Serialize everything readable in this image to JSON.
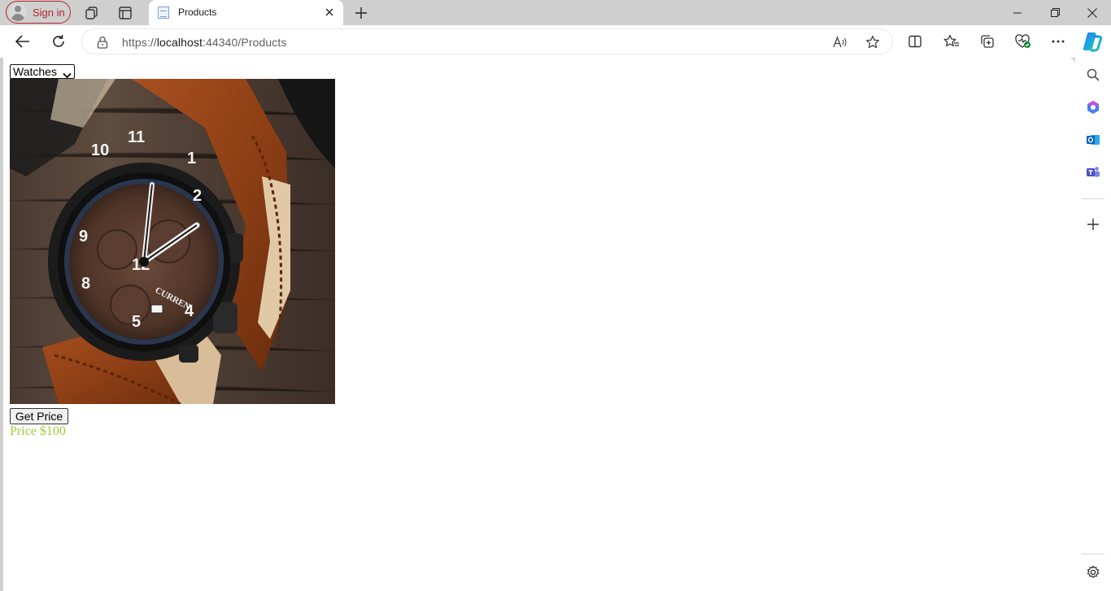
{
  "browser": {
    "signin_label": "Sign in",
    "tab_title": "Products",
    "url_prefix": "https://",
    "url_host": "localhost",
    "url_rest": ":44340/Products"
  },
  "page": {
    "category_selected": "Watches",
    "product_image_alt": "CURREN wrist watch",
    "watch_brand": "CURREN",
    "get_price_label": "Get Price",
    "price_text": "Price $100"
  },
  "colors": {
    "price": "#9acd32",
    "signin_accent": "#b8262d"
  },
  "icons": [
    "person-icon",
    "workspaces-icon",
    "tab-actions-icon",
    "page-favicon",
    "close-icon",
    "plus-icon",
    "minimize-icon",
    "restore-icon",
    "window-close-icon",
    "back-icon",
    "refresh-icon",
    "lock-icon",
    "read-aloud-icon",
    "favorite-star-icon",
    "split-screen-icon",
    "favorites-icon",
    "collections-icon",
    "browser-essentials-icon",
    "more-icon",
    "copilot-icon",
    "search-icon",
    "copilot-sidebar-icon",
    "outlook-icon",
    "teams-icon",
    "add-icon",
    "settings-icon"
  ]
}
